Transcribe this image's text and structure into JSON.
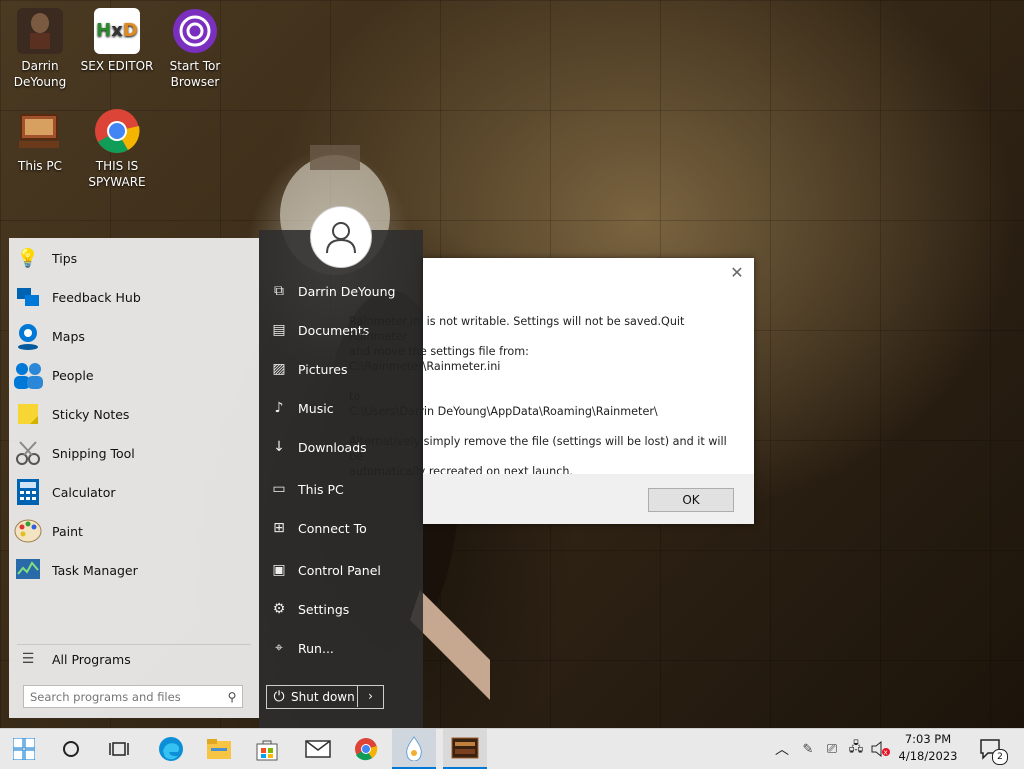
{
  "desktop": {
    "icons": [
      {
        "label": "Darrin DeYoung"
      },
      {
        "label": "SEX EDITOR"
      },
      {
        "label": "Start Tor Browser"
      },
      {
        "label": "This PC"
      },
      {
        "label": "THIS IS SPYWARE"
      }
    ]
  },
  "start_menu": {
    "programs": [
      {
        "label": "Tips",
        "icon": "lightbulb-icon"
      },
      {
        "label": "Feedback Hub",
        "icon": "feedback-icon"
      },
      {
        "label": "Maps",
        "icon": "map-pin-icon"
      },
      {
        "label": "People",
        "icon": "people-icon"
      },
      {
        "label": "Sticky Notes",
        "icon": "sticky-note-icon"
      },
      {
        "label": "Snipping Tool",
        "icon": "scissors-icon"
      },
      {
        "label": "Calculator",
        "icon": "calculator-icon"
      },
      {
        "label": "Paint",
        "icon": "palette-icon"
      },
      {
        "label": "Task Manager",
        "icon": "chart-icon"
      }
    ],
    "all_programs": "All Programs",
    "search_placeholder": "Search programs and files",
    "right_items": [
      {
        "label": "Darrin DeYoung",
        "icon": "user-folder-icon"
      },
      {
        "label": "Documents",
        "icon": "document-icon"
      },
      {
        "label": "Pictures",
        "icon": "picture-icon"
      },
      {
        "label": "Music",
        "icon": "music-icon"
      },
      {
        "label": "Downloads",
        "icon": "download-icon"
      },
      {
        "label": "This PC",
        "icon": "monitor-icon"
      },
      {
        "label": "Connect To",
        "icon": "network-icon"
      },
      {
        "label": "Control Panel",
        "icon": "control-panel-icon"
      },
      {
        "label": "Settings",
        "icon": "gear-icon"
      },
      {
        "label": "Run...",
        "icon": "run-icon"
      }
    ],
    "shutdown_label": "Shut down"
  },
  "dialog": {
    "line1": "Rainmeter.ini is not writable. Settings will not be saved.Quit Rainmeter",
    "line2": "and move the settings file from:",
    "line3": "C:\\Rainmeter\\Rainmeter.ini",
    "line4": "to",
    "line5": "C:\\Users\\Darrin DeYoung\\AppData\\Roaming\\Rainmeter\\",
    "line6": "Alternatively simply remove the file (settings will be lost) and it will be",
    "line7": "automatically recreated on next launch.",
    "ok_label": "OK"
  },
  "taskbar": {
    "time": "7:03 PM",
    "date": "4/18/2023",
    "notification_count": "2"
  },
  "colors": {
    "accent": "#0078d7",
    "start_bg": "#f0f0f0",
    "right_bg": "#2d2d2d"
  }
}
